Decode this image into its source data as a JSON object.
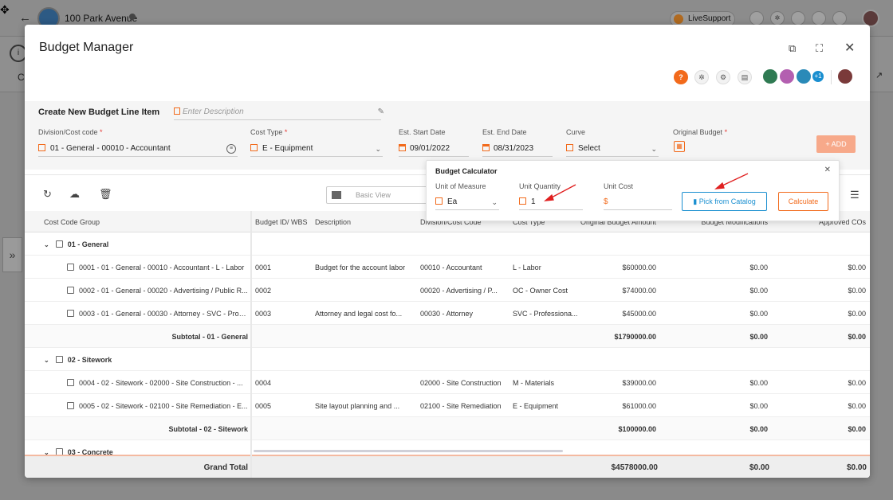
{
  "topbar": {
    "project_name": "100 Park Avenue",
    "live_support": "LiveSupport"
  },
  "modal": {
    "title": "Budget Manager"
  },
  "new_item": {
    "title": "Create New Budget Line Item",
    "description_placeholder": "Enter Description",
    "fields": {
      "division_label": "Division/Cost code",
      "division_value": "01 - General - 00010 - Accountant",
      "cost_type_label": "Cost Type",
      "cost_type_value": "E - Equipment",
      "start_label": "Est. Start Date",
      "start_value": "09/01/2022",
      "end_label": "Est. End Date",
      "end_value": "08/31/2023",
      "curve_label": "Curve",
      "curve_value": "Select",
      "original_budget_label": "Original Budget",
      "required_mark": "*"
    },
    "add_label": "+ ADD"
  },
  "calculator": {
    "title": "Budget Calculator",
    "uom_label": "Unit of Measure",
    "uom_value": "Ea",
    "qty_label": "Unit Quantity",
    "qty_value": "1",
    "cost_label": "Unit Cost",
    "cost_symbol": "$",
    "catalog_label": "Pick from Catalog",
    "calculate_label": "Calculate"
  },
  "toolbar": {
    "view_label": "Basic View"
  },
  "grid": {
    "headers": {
      "group": "Cost Code Group",
      "budget_id": "Budget ID/ WBS",
      "description": "Description",
      "division": "Division/Cost Code",
      "cost_type": "Cost Type",
      "original": "Original Budget Amount",
      "mods": "Budget Modifications",
      "approved": "Approved COs"
    },
    "rows": [
      {
        "kind": "group",
        "label": "01 - General"
      },
      {
        "kind": "item",
        "label": "0001 - 01 - General - 00010 - Accountant - L - Labor",
        "id": "0001",
        "desc": "Budget for the account labor",
        "division": "00010 - Accountant",
        "type": "L - Labor",
        "original": "$60000.00",
        "mods": "$0.00",
        "approved": "$0.00"
      },
      {
        "kind": "item",
        "label": "0002 - 01 - General - 00020 - Advertising / Public R...",
        "id": "0002",
        "desc": "",
        "division": "00020 - Advertising / P...",
        "type": "OC - Owner Cost",
        "original": "$74000.00",
        "mods": "$0.00",
        "approved": "$0.00"
      },
      {
        "kind": "item",
        "label": "0003 - 01 - General - 00030 - Attorney - SVC - Profe...",
        "id": "0003",
        "desc": "Attorney and legal cost fo...",
        "division": "00030 - Attorney",
        "type": "SVC - Professiona...",
        "original": "$45000.00",
        "mods": "$0.00",
        "approved": "$0.00"
      },
      {
        "kind": "subtotal",
        "label": "Subtotal - 01 - General",
        "original": "$1790000.00",
        "mods": "$0.00",
        "approved": "$0.00"
      },
      {
        "kind": "group",
        "label": "02 - Sitework"
      },
      {
        "kind": "item",
        "label": "0004 - 02 - Sitework - 02000 - Site Construction - ...",
        "id": "0004",
        "desc": "",
        "division": "02000 - Site Construction",
        "type": "M - Materials",
        "original": "$39000.00",
        "mods": "$0.00",
        "approved": "$0.00"
      },
      {
        "kind": "item",
        "label": "0005 - 02 - Sitework - 02100 - Site Remediation - E...",
        "id": "0005",
        "desc": "Site layout planning and ...",
        "division": "02100 - Site Remediation",
        "type": "E - Equipment",
        "original": "$61000.00",
        "mods": "$0.00",
        "approved": "$0.00"
      },
      {
        "kind": "subtotal",
        "label": "Subtotal - 02 - Sitework",
        "original": "$100000.00",
        "mods": "$0.00",
        "approved": "$0.00"
      },
      {
        "kind": "group",
        "label": "03 - Concrete"
      }
    ],
    "grand": {
      "label": "Grand Total",
      "original": "$4578000.00",
      "mods": "$0.00",
      "approved": "$0.00"
    }
  },
  "avatars": {
    "extra_count": "+1"
  },
  "colors": {
    "accent": "#f26a1b",
    "link": "#1a8fd0",
    "arrow": "#e02020"
  }
}
